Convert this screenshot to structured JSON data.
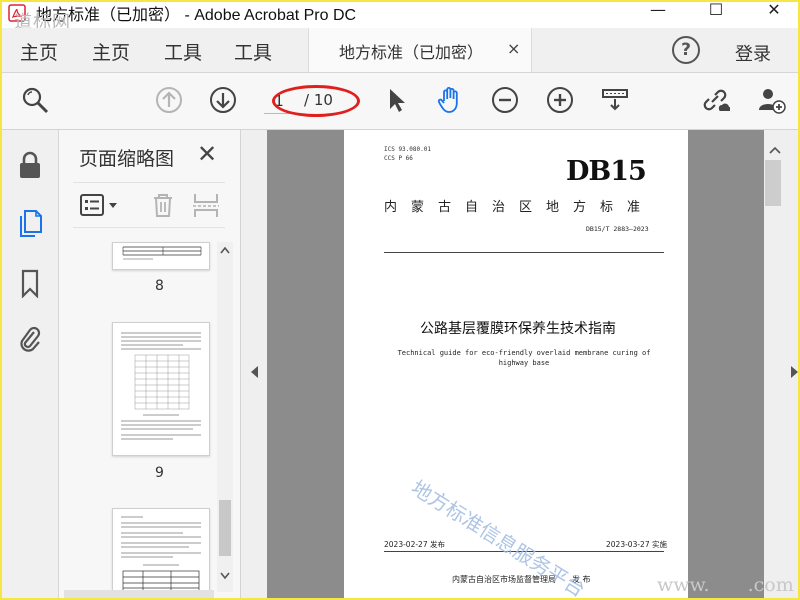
{
  "window": {
    "title": "地方标准（已加密） - Adobe Acrobat Pro DC",
    "watermark_top_left": "道标网",
    "minimize": "—",
    "maximize": "☐",
    "close": "✕"
  },
  "menubar": {
    "items": [
      "主页",
      "主页",
      "工具",
      "工具"
    ],
    "doc_tab": "地方标准（已加密）",
    "doc_tab_close": "×",
    "help": "?",
    "login": "登录"
  },
  "toolbar": {
    "page_current": "1",
    "page_total": "/ 10"
  },
  "thumbnail_panel": {
    "title": "页面缩略图",
    "close": "✕",
    "pages": [
      "8",
      "9"
    ]
  },
  "document": {
    "ics": "ICS 93.080.01",
    "ccs": "CCS P 66",
    "code": "DB15",
    "region_standard": "内蒙古自治区地方标准",
    "standard_number": "DB15/T 2883—2023",
    "title_cn": "公路基层覆膜环保养生技术指南",
    "title_en": "Technical guide for eco-friendly overlaid membrane curing of highway base",
    "publish_date": "2023-02-27 发布",
    "implement_date": "2023-03-27 实施",
    "issuer": "内蒙古自治区市场监督管理局　　发 布",
    "watermark": "地方标准信息服务平台",
    "watermark_bottom_right": "www.　　.com"
  },
  "colors": {
    "accent_blue": "#1a73e8",
    "highlight_red": "#e0201e",
    "frame_yellow": "#f5e642"
  }
}
